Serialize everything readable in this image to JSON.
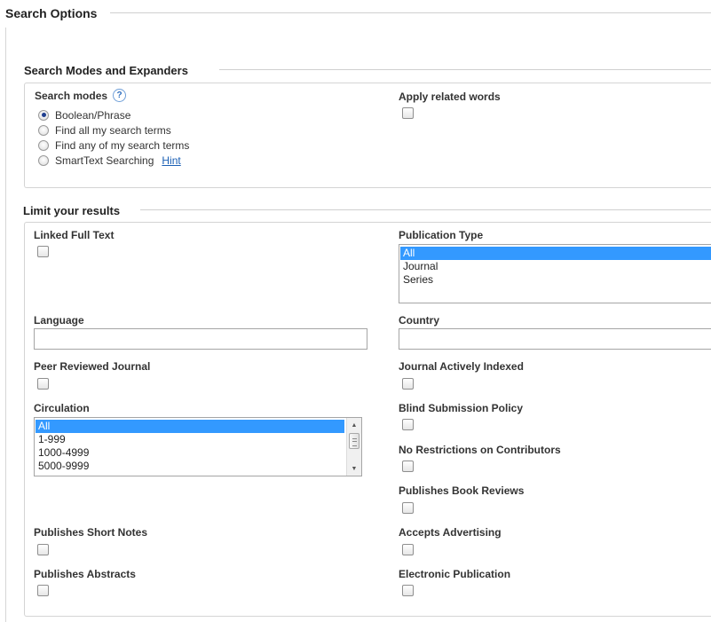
{
  "page": {
    "title": "Search Options"
  },
  "modes_section": {
    "title": "Search Modes and Expanders",
    "search_modes_label": "Search modes",
    "help_glyph": "?",
    "modes": [
      {
        "label": "Boolean/Phrase",
        "checked": true
      },
      {
        "label": "Find all my search terms",
        "checked": false
      },
      {
        "label": "Find any of my search terms",
        "checked": false
      },
      {
        "label": "SmartText Searching",
        "checked": false
      }
    ],
    "hint_link": "Hint",
    "apply_related_words_label": "Apply related words"
  },
  "limits_section": {
    "title": "Limit your results",
    "linked_full_text": "Linked Full Text",
    "publication_type": {
      "label": "Publication Type",
      "options": [
        "All",
        "Journal",
        "Series"
      ],
      "selected": "All"
    },
    "language": {
      "label": "Language",
      "value": ""
    },
    "country": {
      "label": "Country",
      "value": ""
    },
    "peer_reviewed": "Peer Reviewed Journal",
    "journal_actively_indexed": "Journal Actively Indexed",
    "circulation": {
      "label": "Circulation",
      "options": [
        "All",
        "1-999",
        "1000-4999",
        "5000-9999"
      ],
      "selected": "All"
    },
    "blind_submission": "Blind Submission Policy",
    "no_restrictions": "No Restrictions on Contributors",
    "book_reviews": "Publishes Book Reviews",
    "short_notes": "Publishes Short Notes",
    "accepts_advertising": "Accepts Advertising",
    "abstracts": "Publishes Abstracts",
    "electronic_publication": "Electronic Publication"
  }
}
